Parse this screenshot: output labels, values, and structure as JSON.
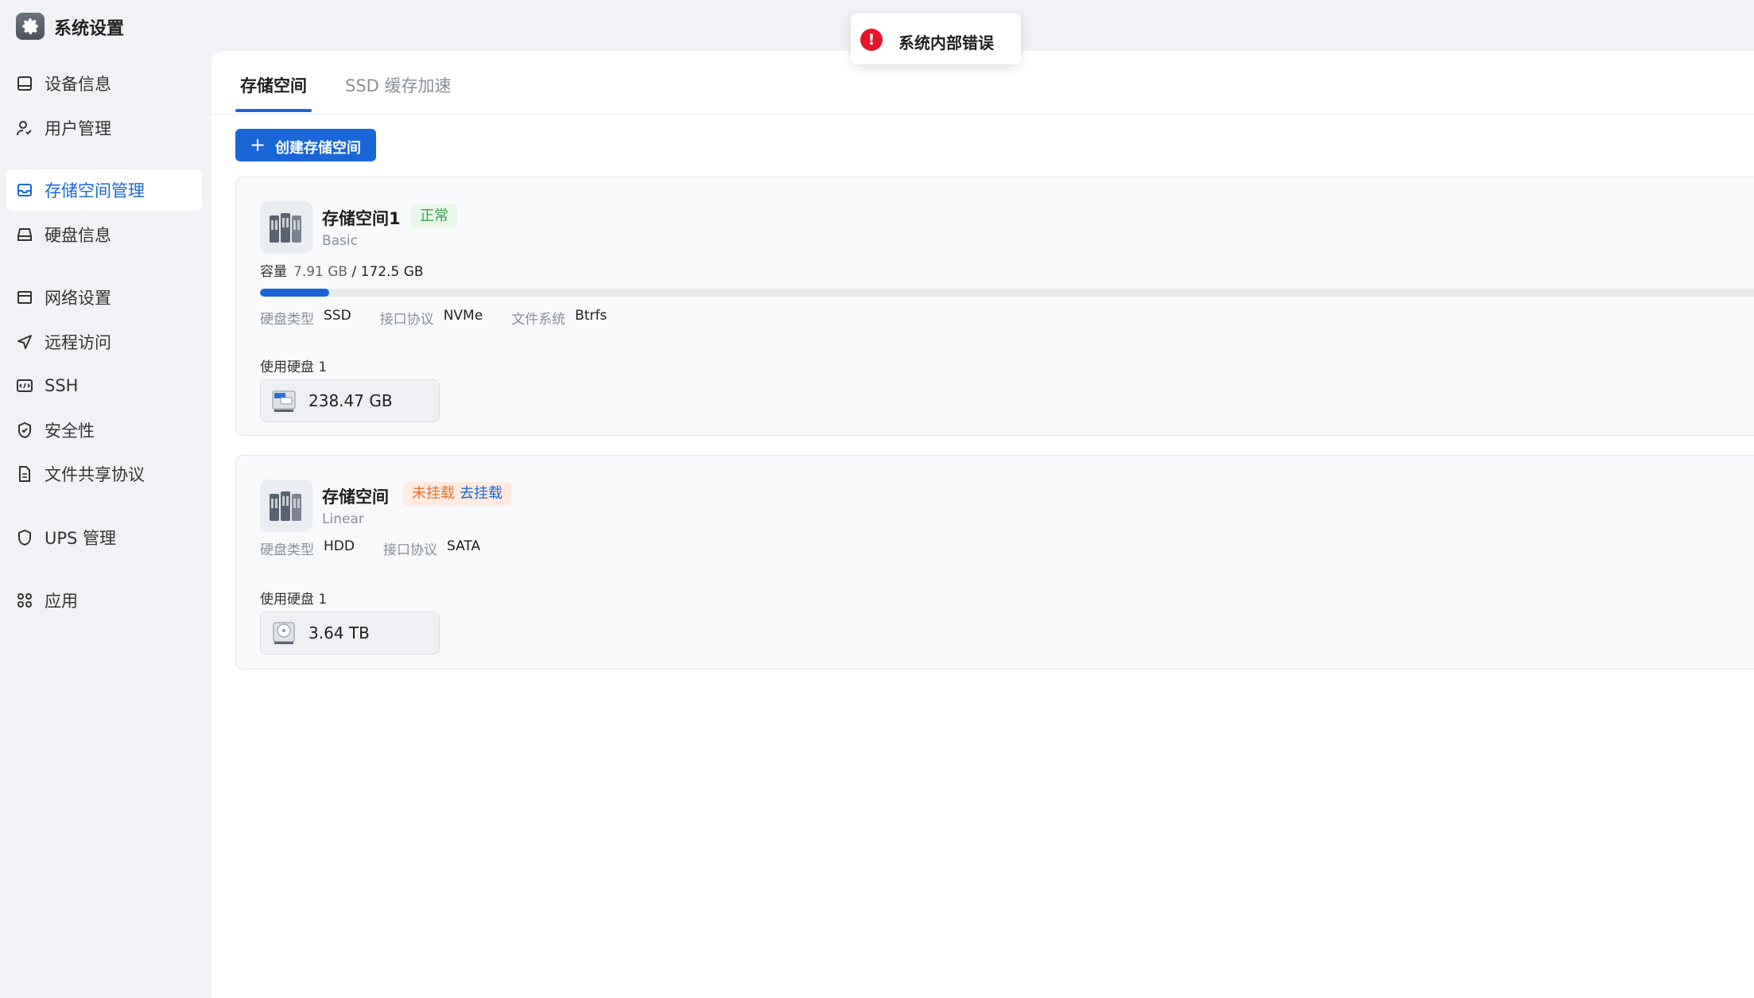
{
  "app": {
    "title": "系统设置"
  },
  "sidebar": {
    "items": [
      {
        "label": "设备信息",
        "icon": "device-icon"
      },
      {
        "label": "用户管理",
        "icon": "user-icon"
      },
      {
        "label": "存储空间管理",
        "icon": "storage-icon",
        "active": true
      },
      {
        "label": "硬盘信息",
        "icon": "harddisk-icon"
      },
      {
        "label": "网络设置",
        "icon": "network-icon"
      },
      {
        "label": "远程访问",
        "icon": "remote-icon"
      },
      {
        "label": "SSH",
        "icon": "ssh-icon"
      },
      {
        "label": "安全性",
        "icon": "shield-icon"
      },
      {
        "label": "文件共享协议",
        "icon": "file-icon"
      },
      {
        "label": "UPS 管理",
        "icon": "ups-icon"
      },
      {
        "label": "应用",
        "icon": "apps-icon"
      }
    ]
  },
  "tabs": [
    {
      "label": "存储空间"
    },
    {
      "label": "SSD 缓存加速"
    }
  ],
  "toolbar": {
    "create_label": "创建存储空间"
  },
  "pools": [
    {
      "name": "存储空间1",
      "status": "正常",
      "type": "Basic",
      "capacity_label": "容量",
      "used": "7.91 GB",
      "total": "/ 172.5 GB",
      "usage_fraction": 0.046,
      "disk_type_label": "硬盘类型",
      "disk_type": "SSD",
      "interface_label": "接口协议",
      "interface": "NVMe",
      "fs_label": "文件系统",
      "fs": "Btrfs",
      "used_disks_label": "使用硬盘 1",
      "disk_size": "238.47 GB",
      "disk_icon": "ssd-icon"
    },
    {
      "name": "存储空间",
      "status": "未挂载",
      "action": "去挂载",
      "type": "Linear",
      "disk_type_label": "硬盘类型",
      "disk_type": "HDD",
      "interface_label": "接口协议",
      "interface": "SATA",
      "used_disks_label": "使用硬盘 1",
      "disk_size": "3.64 TB",
      "disk_icon": "hdd-icon"
    }
  ],
  "toast": {
    "message": "系统内部错误",
    "icon": "error-icon"
  },
  "colors": {
    "accent": "#1a66d9",
    "ok": "#3aa14a",
    "warn": "#e8722a",
    "error": "#e8142c"
  }
}
